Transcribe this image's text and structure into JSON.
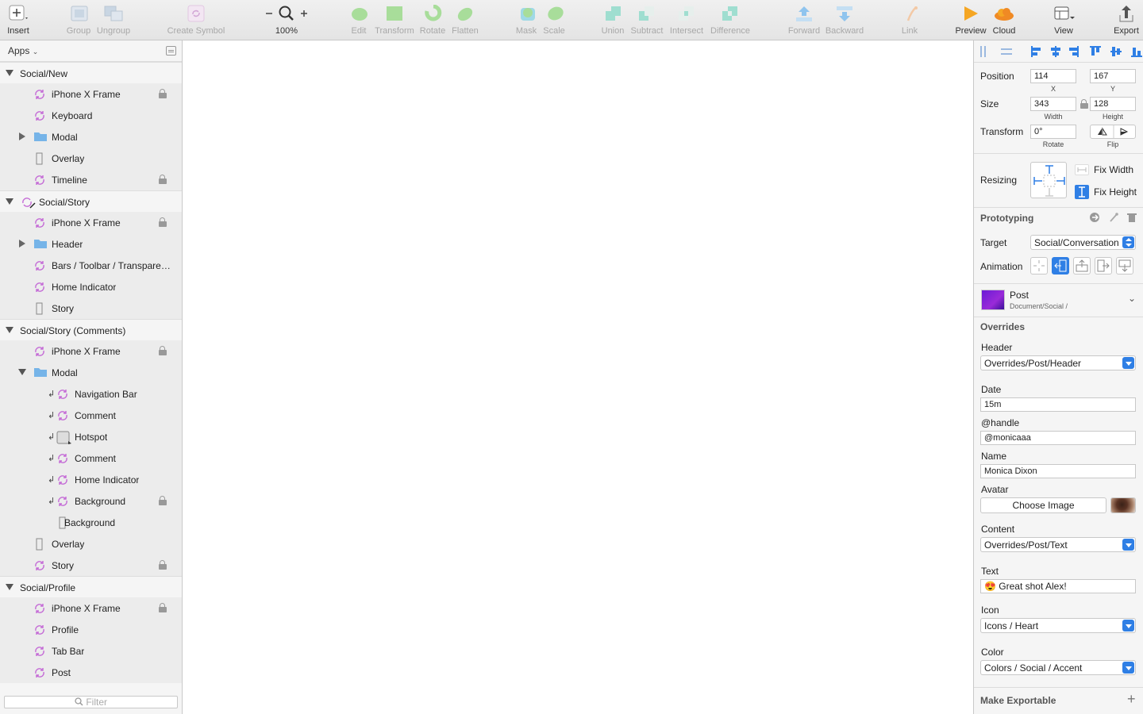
{
  "toolbar": {
    "insert": "Insert",
    "group": "Group",
    "ungroup": "Ungroup",
    "create_symbol": "Create Symbol",
    "zoom": "100%",
    "edit": "Edit",
    "transform": "Transform",
    "rotate": "Rotate",
    "flatten": "Flatten",
    "mask": "Mask",
    "scale": "Scale",
    "union": "Union",
    "subtract": "Subtract",
    "intersect": "Intersect",
    "difference": "Difference",
    "forward": "Forward",
    "backward": "Backward",
    "link": "Link",
    "preview": "Preview",
    "cloud": "Cloud",
    "view": "View",
    "export": "Export"
  },
  "pages": {
    "title": "Apps"
  },
  "layers": [
    {
      "label": "Social/New",
      "type": "artboard"
    },
    {
      "label": "iPhone X Frame",
      "type": "symbol",
      "locked": true
    },
    {
      "label": "Keyboard",
      "type": "symbol"
    },
    {
      "label": "Modal",
      "type": "folder"
    },
    {
      "label": "Overlay",
      "type": "rect"
    },
    {
      "label": "Timeline",
      "type": "symbol",
      "locked": true
    },
    {
      "label": "Social/Story",
      "type": "symbol-artboard"
    },
    {
      "label": "iPhone X Frame",
      "type": "symbol",
      "locked": true
    },
    {
      "label": "Header",
      "type": "folder"
    },
    {
      "label": "Bars / Toolbar / Transparent…",
      "type": "symbol"
    },
    {
      "label": "Home Indicator",
      "type": "symbol"
    },
    {
      "label": "Story",
      "type": "rect"
    },
    {
      "label": "Social/Story (Comments)",
      "type": "artboard"
    },
    {
      "label": "iPhone X Frame",
      "type": "symbol",
      "locked": true
    },
    {
      "label": "Modal",
      "type": "folder"
    },
    {
      "label": "Navigation Bar",
      "type": "symbol"
    },
    {
      "label": "Comment",
      "type": "symbol"
    },
    {
      "label": "Hotspot",
      "type": "hotspot"
    },
    {
      "label": "Comment",
      "type": "symbol"
    },
    {
      "label": "Home Indicator",
      "type": "symbol"
    },
    {
      "label": "Background",
      "type": "symbol",
      "locked": true
    },
    {
      "label": "Background",
      "type": "rect"
    },
    {
      "label": "Overlay",
      "type": "rect"
    },
    {
      "label": "Story",
      "type": "symbol",
      "locked": true
    },
    {
      "label": "Social/Profile",
      "type": "artboard"
    },
    {
      "label": "iPhone X Frame",
      "type": "symbol",
      "locked": true
    },
    {
      "label": "Profile",
      "type": "symbol"
    },
    {
      "label": "Tab Bar",
      "type": "symbol"
    },
    {
      "label": "Post",
      "type": "symbol"
    }
  ],
  "filter": {
    "placeholder": "Filter"
  },
  "inspector": {
    "position_label": "Position",
    "x": "114",
    "y": "167",
    "x_label": "X",
    "y_label": "Y",
    "size_label": "Size",
    "width": "343",
    "height": "128",
    "width_label": "Width",
    "height_label": "Height",
    "transform_label": "Transform",
    "rotate_value": "0°",
    "rotate_label": "Rotate",
    "flip_label": "Flip",
    "resizing_label": "Resizing",
    "fix_width": "Fix Width",
    "fix_height": "Fix Height",
    "prototyping": "Prototyping",
    "target_label": "Target",
    "target_value": "Social/Conversation",
    "animation_label": "Animation",
    "symbol_name": "Post",
    "symbol_path": "Document/Social /",
    "overrides": "Overrides",
    "header_label": "Header",
    "header_value": "Overrides/Post/Header",
    "date_label": "Date",
    "date_value": "15m",
    "handle_label": "@handle",
    "handle_value": "@monicaaa",
    "name_label": "Name",
    "name_value": "Monica Dixon",
    "avatar_label": "Avatar",
    "choose_image": "Choose Image",
    "content_label": "Content",
    "content_value": "Overrides/Post/Text",
    "text_label": "Text",
    "text_value": "😍 Great shot Alex!",
    "icon_label": "Icon",
    "icon_value": "Icons / Heart",
    "color_label": "Color",
    "color_value": "Colors / Social / Accent",
    "make_exportable": "Make Exportable"
  },
  "colors": {
    "accent": "#2f7fe5",
    "symbol_icon": "#c46ad6",
    "folder": "#76b4e8",
    "preview": "#f5a623",
    "cloud": "#f08a24",
    "disabled_green": "#7ed076"
  }
}
